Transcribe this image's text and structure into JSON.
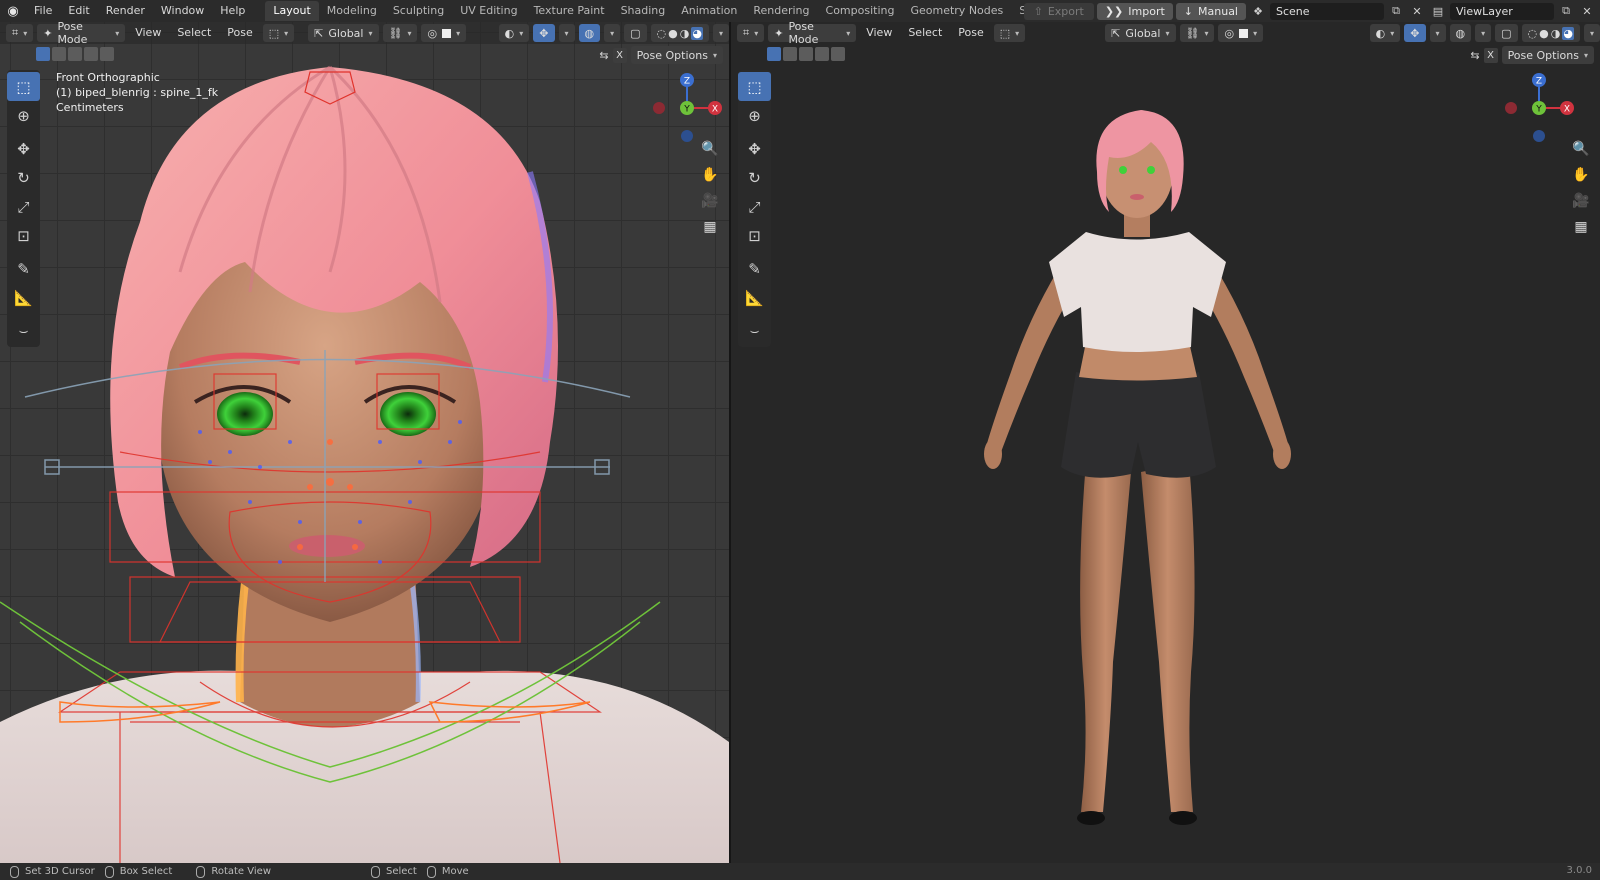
{
  "menu": [
    "File",
    "Edit",
    "Render",
    "Window",
    "Help"
  ],
  "workspaces": [
    "Layout",
    "Modeling",
    "Sculpting",
    "UV Editing",
    "Texture Paint",
    "Shading",
    "Animation",
    "Rendering",
    "Compositing",
    "Geometry Nodes",
    "Scripting"
  ],
  "active_workspace": "Layout",
  "topright": {
    "export_label": "Export",
    "import_label": "Import",
    "manual_label": "Manual",
    "scene_value": "Scene",
    "viewlayer_value": "ViewLayer"
  },
  "left_vp": {
    "mode": "Pose Mode",
    "menus": [
      "View",
      "Select",
      "Pose"
    ],
    "orientation": "Global",
    "pose_options": "Pose Options",
    "x_label": "X",
    "overlay": {
      "view_name": "Front Orthographic",
      "object": "(1) biped_blenrig : spine_1_fk",
      "units": "Centimeters"
    }
  },
  "right_vp": {
    "mode": "Pose Mode",
    "menus": [
      "View",
      "Select",
      "Pose"
    ],
    "orientation": "Global",
    "pose_options": "Pose Options",
    "x_label": "X"
  },
  "gizmo": {
    "z": "Z",
    "y": "Y",
    "x": "X"
  },
  "status": {
    "items": [
      "Set 3D Cursor",
      "Box Select",
      "Rotate View",
      "Select",
      "Move"
    ],
    "version": "3.0.0"
  },
  "colors": {
    "accent": "#4772b3",
    "hair": "#f09aa3",
    "skin": "#c99173",
    "eyes": "#3fd13a",
    "rig_red": "#e0332c",
    "rig_green": "#6ec23a"
  }
}
